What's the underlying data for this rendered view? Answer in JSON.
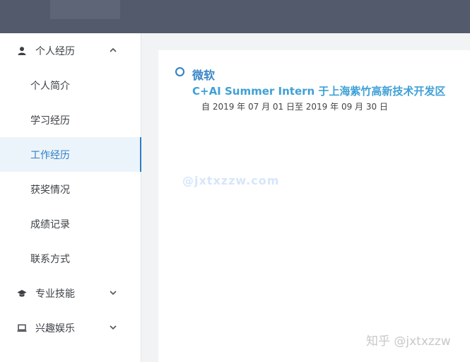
{
  "sidebar": {
    "groups": [
      {
        "label": "个人经历",
        "icon": "person-icon",
        "state": "expanded"
      },
      {
        "label": "专业技能",
        "icon": "graduation-cap-icon",
        "state": "collapsed"
      },
      {
        "label": "兴趣娱乐",
        "icon": "laptop-icon",
        "state": "collapsed"
      }
    ],
    "items": [
      {
        "label": "个人简介"
      },
      {
        "label": "学习经历"
      },
      {
        "label": "工作经历",
        "active": true
      },
      {
        "label": "获奖情况"
      },
      {
        "label": "成绩记录"
      },
      {
        "label": "联系方式"
      }
    ]
  },
  "timeline": {
    "entries": [
      {
        "company": "微软",
        "position": "C+AI Summer Intern 于上海紫竹高新技术开发区",
        "dates": "自 2019 年 07 月 01 日至 2019 年 09 月 30 日"
      }
    ]
  },
  "watermarks": {
    "center": "@jxtxzzw.com",
    "corner": "知乎 @jxtxzzw"
  },
  "colors": {
    "topbar": "#525a6c",
    "accent": "#2f7fc4",
    "active_bg": "#ecf4fb",
    "position_text": "#3fa1d6"
  }
}
